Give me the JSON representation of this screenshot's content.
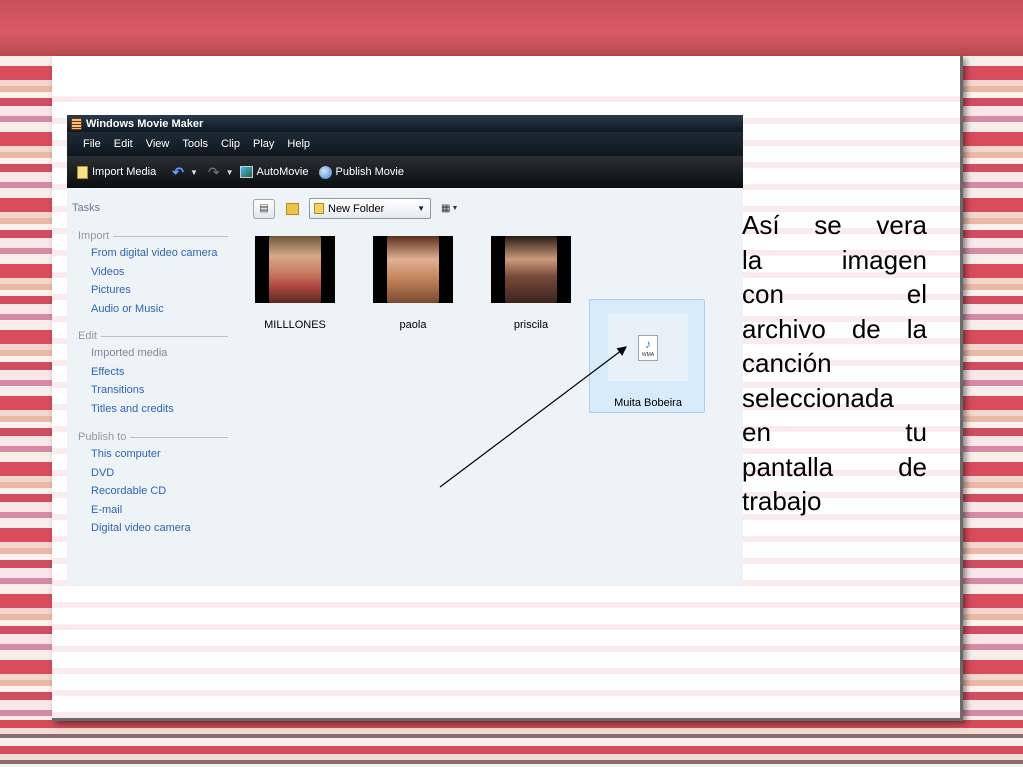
{
  "window": {
    "title": "Windows Movie Maker"
  },
  "menu": [
    "File",
    "Edit",
    "View",
    "Tools",
    "Clip",
    "Play",
    "Help"
  ],
  "toolbar": {
    "import_media": "Import Media",
    "automovie": "AutoMovie",
    "publish_movie": "Publish Movie"
  },
  "tasks": {
    "title": "Tasks",
    "groups": [
      {
        "title": "Import",
        "items": [
          "From digital video camera",
          "Videos",
          "Pictures",
          "Audio or Music"
        ]
      },
      {
        "title": "Edit",
        "items": [
          "Imported media",
          "Effects",
          "Transitions",
          "Titles and credits"
        ]
      },
      {
        "title": "Publish to",
        "items": [
          "This computer",
          "DVD",
          "Recordable CD",
          "E-mail",
          "Digital video camera"
        ]
      }
    ]
  },
  "collection": {
    "folder": "New Folder"
  },
  "clips": [
    {
      "label": "MILLLONES",
      "color": "#b0483f"
    },
    {
      "label": "paola",
      "color": "#c98a5f"
    },
    {
      "label": "priscila",
      "color": "#7a4a3a"
    },
    {
      "label": "Muita Bobeira",
      "icon_text": "WMA",
      "selected": true
    }
  ],
  "annotation": {
    "lines": [
      "Así se vera",
      "la imagen",
      "con el",
      "archivo de la",
      "canción",
      "seleccionada",
      "en tu",
      "pantalla de",
      "trabajo"
    ]
  }
}
